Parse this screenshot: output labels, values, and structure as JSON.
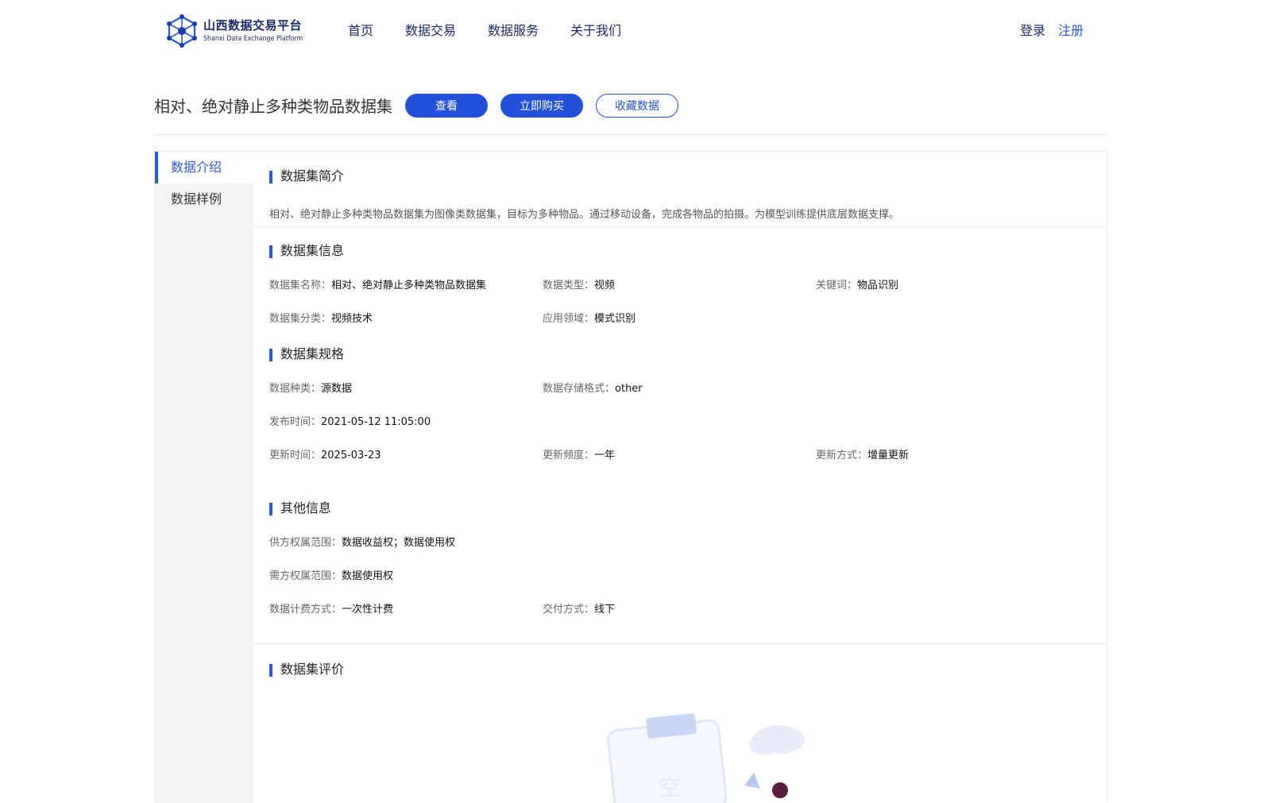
{
  "header": {
    "logo_cn": "山西数据交易平台",
    "logo_en": "Shanxi Data Exchange Platform",
    "nav": [
      "首页",
      "数据交易",
      "数据服务",
      "关于我们"
    ],
    "login": "登录",
    "register": "注册"
  },
  "dataset": {
    "title": "相对、绝对静止多种类物品数据集",
    "btn_view": "查看",
    "btn_buy": "立即购买",
    "btn_fav": "收藏数据"
  },
  "sidebar": {
    "items": [
      {
        "label": "数据介绍",
        "active": true
      },
      {
        "label": "数据样例",
        "active": false
      }
    ]
  },
  "intro": {
    "title": "数据集简介",
    "text": "相对、绝对静止多种类物品数据集为图像类数据集，目标为多种物品。通过移动设备，完成各物品的拍摄。为模型训练提供底层数据支撑。"
  },
  "info": {
    "title": "数据集信息",
    "name_k": "数据集名称：",
    "name_v": "相对、绝对静止多种类物品数据集",
    "type_k": "数据类型：",
    "type_v": "视频",
    "kw_k": "关键词：",
    "kw_v": "物品识别",
    "cat_k": "数据集分类：",
    "cat_v": "视频技术",
    "field_k": "应用领域：",
    "field_v": "模式识别"
  },
  "spec": {
    "title": "数据集规格",
    "kind_k": "数据种类：",
    "kind_v": "源数据",
    "fmt_k": "数据存储格式：",
    "fmt_v": "other",
    "pub_k": "发布时间：",
    "pub_v": "2021-05-12 11:05:00",
    "upd_k": "更新时间：",
    "upd_v": "2025-03-23",
    "freq_k": "更新频度：",
    "freq_v": "一年",
    "mode_k": "更新方式：",
    "mode_v": "增量更新"
  },
  "other": {
    "title": "其他信息",
    "supply_k": "供方权属范围：",
    "supply_v": "数据收益权；数据使用权",
    "demand_k": "需方权属范围：",
    "demand_v": "数据使用权",
    "bill_k": "数据计费方式：",
    "bill_v": "一次性计费",
    "deliver_k": "交付方式：",
    "deliver_v": "线下"
  },
  "review": {
    "title": "数据集评价",
    "illus_text": "空"
  },
  "colors": {
    "primary": "#2350d8",
    "nav_text": "#1b2a6b",
    "sidebar_bg": "#f4f4f4"
  }
}
